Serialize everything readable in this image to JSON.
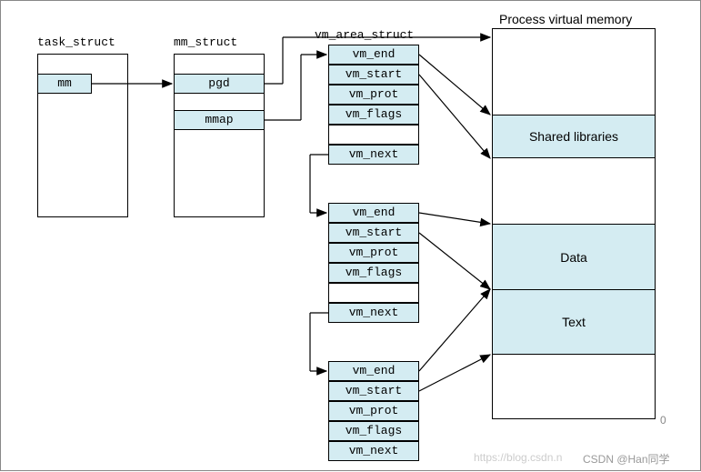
{
  "titles": {
    "task_struct": "task_struct",
    "mm_struct": "mm_struct",
    "vm_area_struct": "vm_area_struct",
    "process_vm": "Process virtual memory"
  },
  "task_struct": {
    "mm": "mm"
  },
  "mm_struct": {
    "pgd": "pgd",
    "mmap": "mmap"
  },
  "vma": {
    "vm_end": "vm_end",
    "vm_start": "vm_start",
    "vm_prot": "vm_prot",
    "vm_flags": "vm_flags",
    "vm_next": "vm_next"
  },
  "memory": {
    "shared_libs": "Shared libraries",
    "data": "Data",
    "text": "Text",
    "zero": "0"
  },
  "watermark": {
    "left": "https://blog.csdn.n",
    "right": "CSDN @Han同学"
  }
}
